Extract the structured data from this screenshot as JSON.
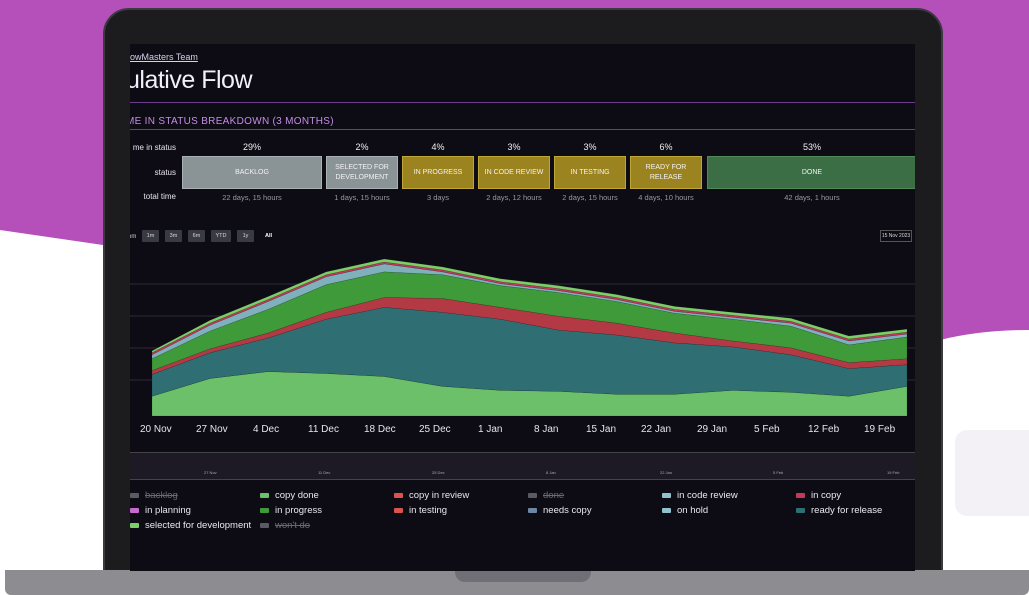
{
  "header": {
    "team_link": "owMasters Team",
    "page_title": "ulative Flow",
    "section_title": "ME IN STATUS BREAKDOWN (3 MONTHS)"
  },
  "breakdown": {
    "row_labels": {
      "percent": "me in status",
      "status": "status",
      "total": "total time"
    },
    "columns": [
      {
        "percent": "29%",
        "status": "BACKLOG",
        "total": "22 days, 15 hours",
        "color": "#8a9396"
      },
      {
        "percent": "2%",
        "status": "SELECTED FOR DEVELOPMENT",
        "total": "1 days, 15 hours",
        "color": "#8a9396"
      },
      {
        "percent": "4%",
        "status": "IN PROGRESS",
        "total": "3 days",
        "color": "#9b8420"
      },
      {
        "percent": "3%",
        "status": "IN CODE REVIEW",
        "total": "2 days, 12 hours",
        "color": "#9b8420"
      },
      {
        "percent": "3%",
        "status": "IN TESTING",
        "total": "2 days, 15 hours",
        "color": "#9b8420"
      },
      {
        "percent": "6%",
        "status": "READY FOR RELEASE",
        "total": "4 days, 10 hours",
        "color": "#9b8420"
      },
      {
        "percent": "53%",
        "status": "DONE",
        "total": "42 days, 1 hours",
        "color": "#3c6e45"
      }
    ]
  },
  "zoom": {
    "label": "om",
    "buttons": [
      "1m",
      "3m",
      "6m",
      "YTD",
      "1y",
      "All"
    ],
    "active": "All",
    "date_field": "15 Nov 2023"
  },
  "chart_data": {
    "type": "area",
    "x": [
      "20 Nov",
      "27 Nov",
      "4 Dec",
      "11 Dec",
      "18 Dec",
      "25 Dec",
      "1 Jan",
      "8 Jan",
      "15 Jan",
      "22 Jan",
      "29 Jan",
      "5 Feb",
      "12 Feb",
      "19 Feb"
    ],
    "xlabel": "",
    "ylabel": "",
    "stacked": true,
    "series": [
      {
        "name": "copy done",
        "color": "#6cc06a",
        "values": [
          20,
          38,
          45,
          43,
          40,
          30,
          26,
          25,
          22,
          22,
          26,
          24,
          20,
          30
        ]
      },
      {
        "name": "ready for release",
        "color": "#2f6f73",
        "values": [
          22,
          26,
          34,
          55,
          70,
          75,
          72,
          62,
          60,
          52,
          44,
          38,
          28,
          22
        ]
      },
      {
        "name": "in testing",
        "color": "#b33a45",
        "values": [
          4,
          4,
          5,
          7,
          10,
          14,
          12,
          14,
          12,
          10,
          6,
          7,
          6,
          6
        ]
      },
      {
        "name": "in progress",
        "color": "#3f9a3a",
        "values": [
          12,
          18,
          24,
          28,
          26,
          24,
          22,
          24,
          22,
          20,
          22,
          22,
          18,
          22
        ]
      },
      {
        "name": "on hold",
        "color": "#7fb0bb",
        "values": [
          4,
          6,
          8,
          8,
          8,
          3,
          2,
          2,
          2,
          2,
          2,
          3,
          4,
          3
        ]
      },
      {
        "name": "in copy",
        "color": "#c13a5a",
        "values": [
          2,
          2,
          2,
          2,
          2,
          2,
          2,
          2,
          2,
          2,
          2,
          2,
          2,
          2
        ]
      },
      {
        "name": "selected for development",
        "color": "#7ccf68",
        "values": [
          2,
          3,
          3,
          3,
          3,
          3,
          3,
          3,
          3,
          3,
          3,
          3,
          3,
          3
        ]
      }
    ]
  },
  "navigator": {
    "ticks": [
      "27 Nov",
      "11 Dec",
      "25 Dec",
      "8 Jan",
      "22 Jan",
      "5 Feb",
      "19 Feb"
    ]
  },
  "legend": [
    {
      "label": "backlog",
      "color": "#5a5a62",
      "off": true
    },
    {
      "label": "copy done",
      "color": "#6cc06a",
      "off": false
    },
    {
      "label": "copy in review",
      "color": "#d9534f",
      "off": false
    },
    {
      "label": "done",
      "color": "#5a5a62",
      "off": true
    },
    {
      "label": "in code review",
      "color": "#8fc2cc",
      "off": false
    },
    {
      "label": "in copy",
      "color": "#c13a5a",
      "off": false
    },
    {
      "label": "in planning",
      "color": "#c46ad0",
      "off": false
    },
    {
      "label": "in progress",
      "color": "#3f9a3a",
      "off": false
    },
    {
      "label": "in testing",
      "color": "#d9534f",
      "off": false
    },
    {
      "label": "needs copy",
      "color": "#6b86a6",
      "off": false
    },
    {
      "label": "on hold",
      "color": "#8fc2cc",
      "off": false
    },
    {
      "label": "ready for release",
      "color": "#2f6f73",
      "off": false
    },
    {
      "label": "selected for development",
      "color": "#7ccf68",
      "off": false
    },
    {
      "label": "won't do",
      "color": "#5a5a62",
      "off": true
    }
  ]
}
